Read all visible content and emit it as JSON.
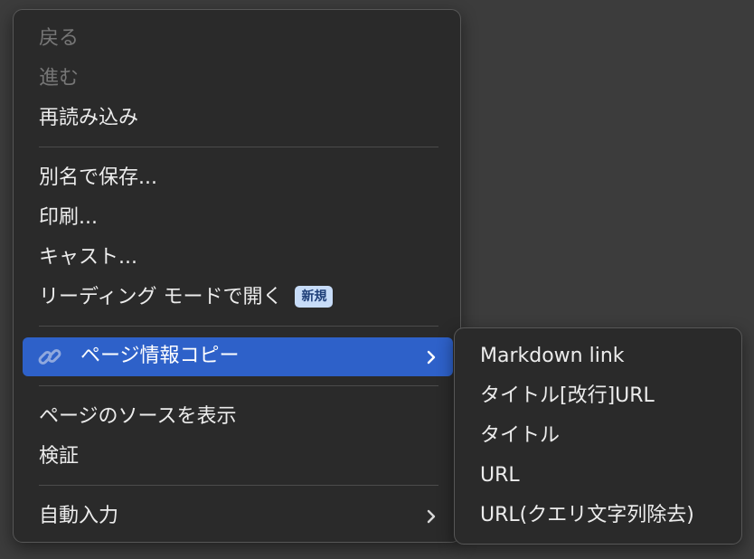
{
  "context_menu": {
    "back": "戻る",
    "forward": "進む",
    "reload": "再読み込み",
    "save_as": "別名で保存...",
    "print": "印刷...",
    "cast": "キャスト...",
    "reading_mode": "リーディング モードで開く",
    "reading_mode_badge": "新規",
    "copy_page_info": "ページ情報コピー",
    "view_source": "ページのソースを表示",
    "inspect": "検証",
    "autofill": "自動入力"
  },
  "submenu": {
    "items": [
      "Markdown link",
      "タイトル[改行]URL",
      "タイトル",
      "URL",
      "URL(クエリ文字列除去)"
    ]
  },
  "colors": {
    "background": "#3c3c3c",
    "menu_bg": "#2a2a2a",
    "highlight": "#2e61c9",
    "badge_bg": "#c7dcf8",
    "badge_text": "#1f3f78",
    "disabled_text": "#767676"
  },
  "icons": {
    "copy_page_info": "link-icon",
    "submenu_arrow": "chevron-right-icon"
  }
}
